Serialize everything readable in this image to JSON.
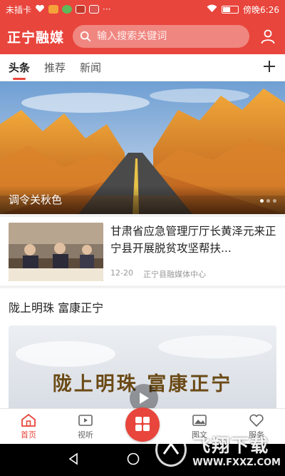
{
  "status_bar": {
    "carrier": "未插卡",
    "time_text": "傍晚6:26"
  },
  "header": {
    "app_logo": "正宁融媒",
    "search_placeholder": "输入搜索关键词",
    "user_icon": "user-icon"
  },
  "tabs": [
    {
      "label": "头条",
      "active": true
    },
    {
      "label": "推荐",
      "active": false
    },
    {
      "label": "新闻",
      "active": false
    }
  ],
  "banner": {
    "caption": "调令关秋色",
    "dots": 3,
    "active_dot": 1
  },
  "news": [
    {
      "title": "甘肃省应急管理厅厅长黄泽元来正宁县开展脱贫攻坚帮扶...",
      "date": "12-20",
      "source": "正宁县融媒体中心"
    }
  ],
  "section": {
    "title": "陇上明珠 富康正宁",
    "video_text": "陇上明珠 富康正宁"
  },
  "bottom_nav": [
    {
      "label": "首页",
      "icon": "home-icon",
      "active": true
    },
    {
      "label": "视听",
      "icon": "video-icon",
      "active": false
    },
    {
      "label": "",
      "icon": "grid-icon",
      "active": false
    },
    {
      "label": "图文",
      "icon": "image-icon",
      "active": false
    },
    {
      "label": "服务",
      "icon": "heart-icon",
      "active": false
    }
  ],
  "watermark": {
    "title": "飞翔下载",
    "url": "WWW.FXXZ.COM"
  },
  "colors": {
    "brand_red": "#e8453c"
  }
}
